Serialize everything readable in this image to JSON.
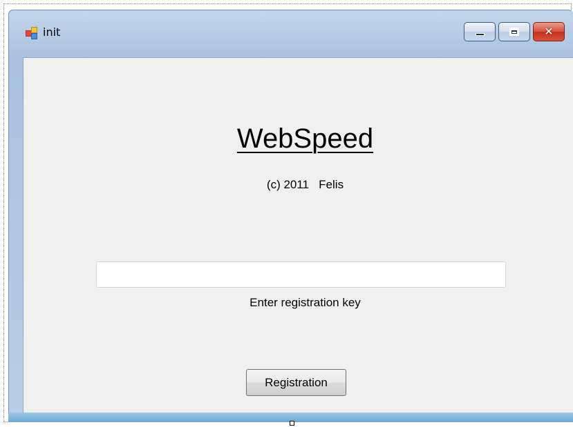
{
  "window": {
    "title": "init",
    "app_icon": "winforms-app-icon",
    "caption_buttons": {
      "minimize_icon": "minimize-icon",
      "maximize_icon": "maximize-icon",
      "close_icon": "close-icon",
      "close_glyph": "✕"
    }
  },
  "form": {
    "app_title": "WebSpeed",
    "copyright": "(c) 2011   Felis",
    "registration_input": {
      "value": "",
      "placeholder": ""
    },
    "registration_label": "Enter registration key",
    "registration_button": "Registration"
  },
  "colors": {
    "form_background": "#f0f0f0",
    "title_bar": "#b6cce6",
    "close_button": "#c6301c"
  }
}
